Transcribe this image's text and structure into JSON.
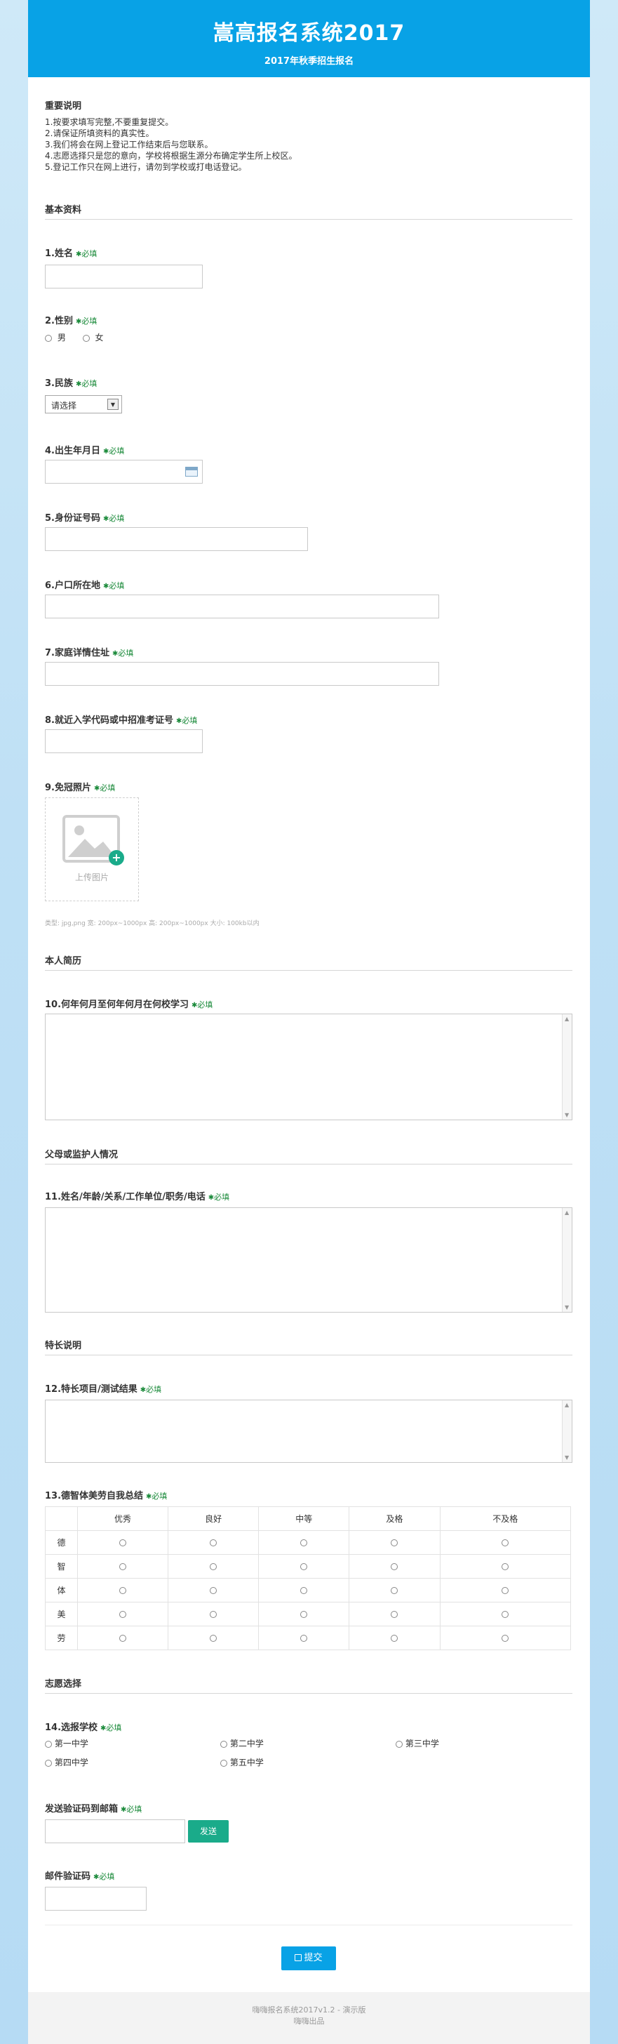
{
  "header": {
    "title": "嵩高报名系统2017",
    "subtitle": "2017年秋季招生报名"
  },
  "notice": {
    "title": "重要说明",
    "lines": [
      "1.按要求填写完整,不要重复提交。",
      "2.请保证所填资料的真实性。",
      "3.我们将会在网上登记工作结束后与您联系。",
      "4.志愿选择只是您的意向，学校将根据生源分布确定学生所上校区。",
      "5.登记工作只在网上进行，请勿到学校或打电话登记。"
    ]
  },
  "required_label": "必填",
  "sections": {
    "basic": "基本资料",
    "resume": "本人简历",
    "parents": "父母或监护人情况",
    "talent": "特长说明",
    "wish": "志愿选择"
  },
  "fields": {
    "f1": "1.姓名",
    "f2": "2.性别",
    "f2_options": [
      "男",
      "女"
    ],
    "f3": "3.民族",
    "f3_select": "请选择",
    "f4": "4.出生年月日",
    "f5": "5.身份证号码",
    "f6": "6.户口所在地",
    "f7": "7.家庭详情住址",
    "f8": "8.就近入学代码或中招准考证号",
    "f9": "9.免冠照片",
    "upload_label": "上传图片",
    "upload_hint": "类型: jpg,png 宽: 200px~1000px 高: 200px~1000px 大小: 100kb以内",
    "f10": "10.何年何月至何年何月在何校学习",
    "f11": "11.姓名/年龄/关系/工作单位/职务/电话",
    "f12": "12.特长项目/测试结果",
    "f13": "13.德智体美劳自我总结",
    "f14": "14.选报学校",
    "email": "发送验证码到邮箱",
    "email_send": "发送",
    "code": "邮件验证码"
  },
  "matrix": {
    "columns": [
      "优秀",
      "良好",
      "中等",
      "及格",
      "不及格"
    ],
    "rows": [
      "德",
      "智",
      "体",
      "美",
      "劳"
    ]
  },
  "schools": [
    "第一中学",
    "第二中学",
    "第三中学",
    "第四中学",
    "第五中学"
  ],
  "submit_label": "提交",
  "footer": {
    "line1": "嗨嗨报名系统2017v1.2 - 演示版",
    "line2": "嗨嗨出品"
  },
  "colors": {
    "brand": "#08a2e6",
    "required": "#1a8a3a",
    "send_button": "#1aab8a"
  }
}
